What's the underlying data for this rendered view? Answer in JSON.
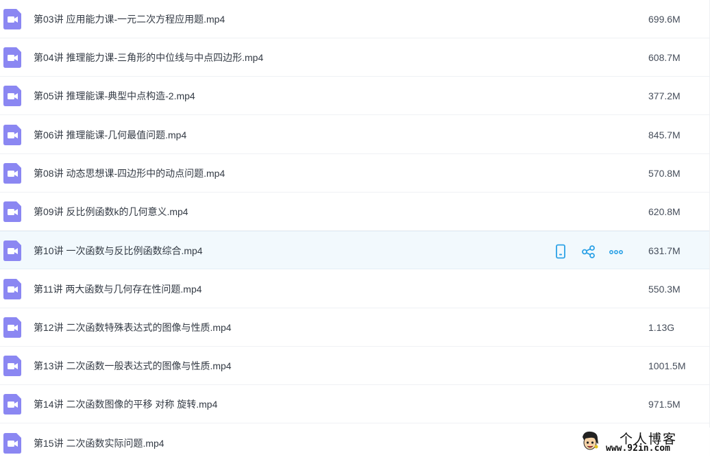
{
  "files": [
    {
      "name": "第03讲 应用能力课-一元二次方程应用题.mp4",
      "size": "699.6M"
    },
    {
      "name": "第04讲 推理能力课-三角形的中位线与中点四边形.mp4",
      "size": "608.7M"
    },
    {
      "name": "第05讲 推理能课-典型中点构造-2.mp4",
      "size": "377.2M"
    },
    {
      "name": "第06讲 推理能课-几何最值问题.mp4",
      "size": "845.7M"
    },
    {
      "name": "第08讲 动态思想课-四边形中的动点问题.mp4",
      "size": "570.8M"
    },
    {
      "name": "第09讲 反比例函数k的几何意义.mp4",
      "size": "620.8M"
    },
    {
      "name": "第10讲 一次函数与反比例函数综合.mp4",
      "size": "631.7M"
    },
    {
      "name": "第11讲 两大函数与几何存在性问题.mp4",
      "size": "550.3M"
    },
    {
      "name": "第12讲 二次函数特殊表达式的图像与性质.mp4",
      "size": "1.13G"
    },
    {
      "name": "第13讲 二次函数一般表达式的图像与性质.mp4",
      "size": "1001.5M"
    },
    {
      "name": "第14讲 二次函数图像的平移 对称 旋转.mp4",
      "size": "971.5M"
    },
    {
      "name": "第15讲 二次函数实际问题.mp4",
      "size": ""
    }
  ],
  "hovered_row_actions": [
    {
      "icon": "phone-icon",
      "label": "phone"
    },
    {
      "icon": "share-icon",
      "label": "share"
    },
    {
      "icon": "more-icon",
      "label": "more"
    }
  ],
  "colors": {
    "video_icon": "#8b87f2",
    "action_icon": "#2ba1e6",
    "hover_row": "#f2f9fd"
  },
  "watermark": {
    "title": "个人博客",
    "url": "www.92in.com"
  }
}
